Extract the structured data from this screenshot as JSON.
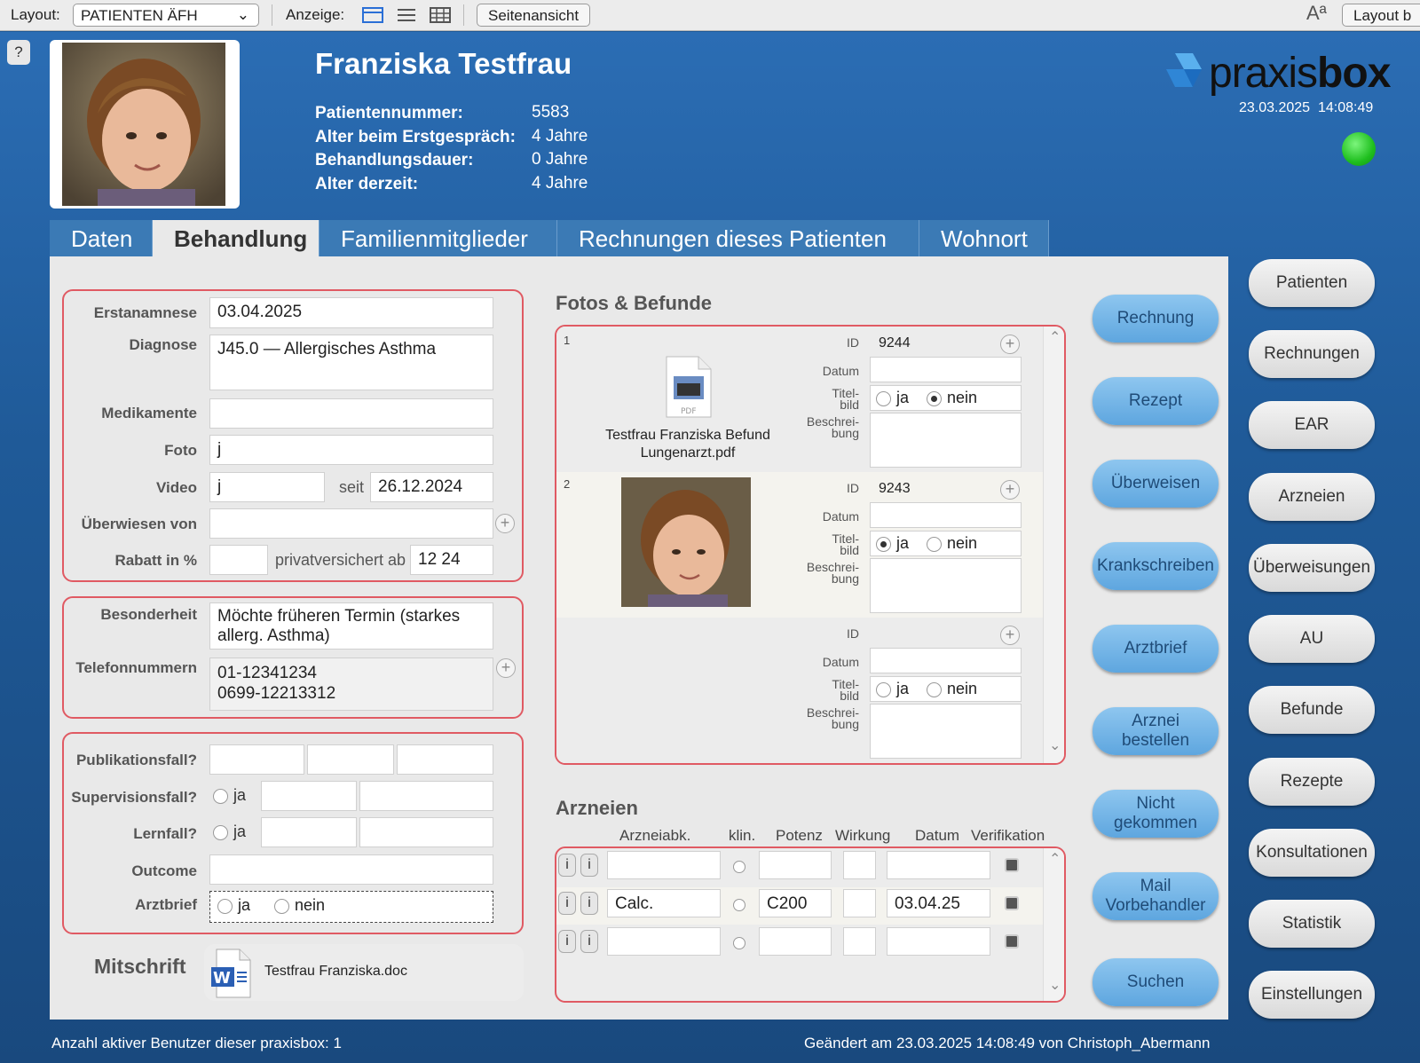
{
  "toolbar": {
    "layout_label": "Layout:",
    "layout_value": "PATIENTEN ÄFH",
    "anzeige_label": "Anzeige:",
    "seitenansicht": "Seitenansicht",
    "font_icon": "Aª",
    "layout_btn": "Layout b"
  },
  "help": "?",
  "patient": {
    "name": "Franziska Testfrau",
    "fields": [
      {
        "label": "Patientennummer:",
        "value": "5583"
      },
      {
        "label": "Alter beim Erstgespräch:",
        "value": "4 Jahre"
      },
      {
        "label": "Behandlungsdauer:",
        "value": "0 Jahre"
      },
      {
        "label": "Alter derzeit:",
        "value": "4 Jahre"
      }
    ]
  },
  "brand": {
    "text_light": "praxis",
    "text_bold": "box",
    "datetime": "23.03.2025  14:08:49",
    "status_color": "#2ed12e"
  },
  "tabs": [
    "Daten",
    "Behandlung",
    "Familienmitglieder",
    "Rechnungen dieses Patienten",
    "Wohnort"
  ],
  "form": {
    "erstanamnese": {
      "label": "Erstanamnese",
      "value": "03.04.2025"
    },
    "diagnose": {
      "label": "Diagnose",
      "value": "J45.0 — Allergisches Asthma"
    },
    "medikamente": {
      "label": "Medikamente",
      "value": ""
    },
    "foto": {
      "label": "Foto",
      "value": "j"
    },
    "video": {
      "label": "Video",
      "value": "j",
      "seit_label": "seit",
      "seit_value": "26.12.2024"
    },
    "ueberwiesen": {
      "label": "Überwiesen von",
      "value": ""
    },
    "rabatt": {
      "label": "Rabatt in %",
      "value": "",
      "privat_label": "privatversichert ab",
      "privat_value": "12 24"
    },
    "besonderheit": {
      "label": "Besonderheit",
      "value": "Möchte früheren Termin (starkes allerg. Asthma)"
    },
    "telefon": {
      "label": "Telefonnummern",
      "line1": "01-12341234",
      "line2": "0699-12213312"
    },
    "publikation": {
      "label": "Publikationsfall?"
    },
    "supervision": {
      "label": "Supervisionsfall?",
      "ja": "ja"
    },
    "lernfall": {
      "label": "Lernfall?",
      "ja": "ja"
    },
    "outcome": {
      "label": "Outcome",
      "value": ""
    },
    "arztbrief": {
      "label": "Arztbrief",
      "ja": "ja",
      "nein": "nein"
    },
    "mitschrift": {
      "label": "Mitschrift",
      "file": "Testfrau Franziska.doc"
    }
  },
  "fotos": {
    "title": "Fotos & Befunde",
    "labels": {
      "id": "ID",
      "datum": "Datum",
      "titelbild": "Titel-\nbild",
      "beschreibung": "Beschrei-\nbung",
      "ja": "ja",
      "nein": "nein"
    },
    "records": [
      {
        "num": "1",
        "id": "9244",
        "file": "Testfrau Franziska Befund Lungenarzt.pdf",
        "pdf_tag": "PDF",
        "titelbild": "nein"
      },
      {
        "num": "2",
        "id": "9243",
        "titelbild": "ja"
      },
      {
        "num": "",
        "id": "",
        "titelbild": "none"
      }
    ]
  },
  "arzneien": {
    "title": "Arzneien",
    "columns": [
      "Arzneiabk.",
      "klin.",
      "Potenz",
      "Wirkung",
      "Datum",
      "Verifikation"
    ],
    "rows": [
      {
        "abk": "",
        "potenz": "",
        "wirkung": "",
        "datum": ""
      },
      {
        "abk": "Calc.",
        "potenz": "C200",
        "wirkung": "",
        "datum": "03.04.25"
      },
      {
        "abk": "",
        "potenz": "",
        "wirkung": "",
        "datum": ""
      }
    ],
    "i": "i"
  },
  "action_buttons": [
    "Rechnung",
    "Rezept",
    "Überweisen",
    "Krankschreiben",
    "Arztbrief",
    "Arznei bestellen",
    "Nicht gekommen",
    "Mail Vorbehandler",
    "Suchen"
  ],
  "nav_buttons": [
    "Patienten",
    "Rechnungen",
    "EAR",
    "Arzneien",
    "Überweisungen",
    "AU",
    "Befunde",
    "Rezepte",
    "Konsultationen",
    "Statistik",
    "Einstellungen"
  ],
  "footer": {
    "left": "Anzahl aktiver Benutzer dieser praxisbox: 1",
    "right": "Geändert am 23.03.2025 14:08:49 von Christoph_Abermann"
  }
}
